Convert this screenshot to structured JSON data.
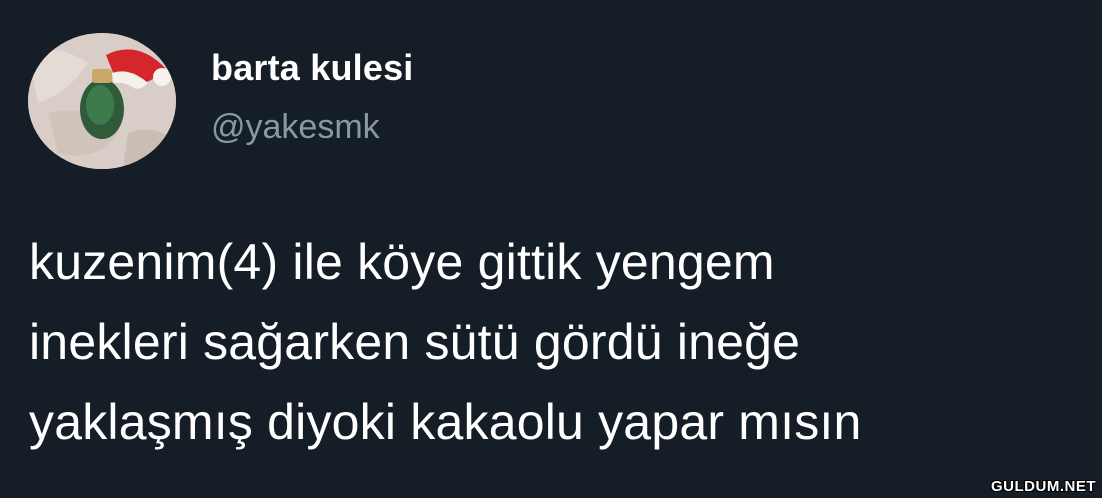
{
  "tweet": {
    "author": {
      "display_name": "barta kulesi",
      "handle": "@yakesmk",
      "avatar_icon": "avatar-santa-hat-icon"
    },
    "text_lines": [
      "kuzenim(4) ile köye gittik yengem",
      "inekleri sağarken sütü gördü ineğe",
      "yaklaşmış diyoki kakaolu yapar mısın"
    ]
  },
  "watermark": {
    "text": "GULDUM.NET"
  },
  "colors": {
    "background": "#151d27",
    "text_primary": "#ffffff",
    "text_secondary": "#8899a6"
  }
}
